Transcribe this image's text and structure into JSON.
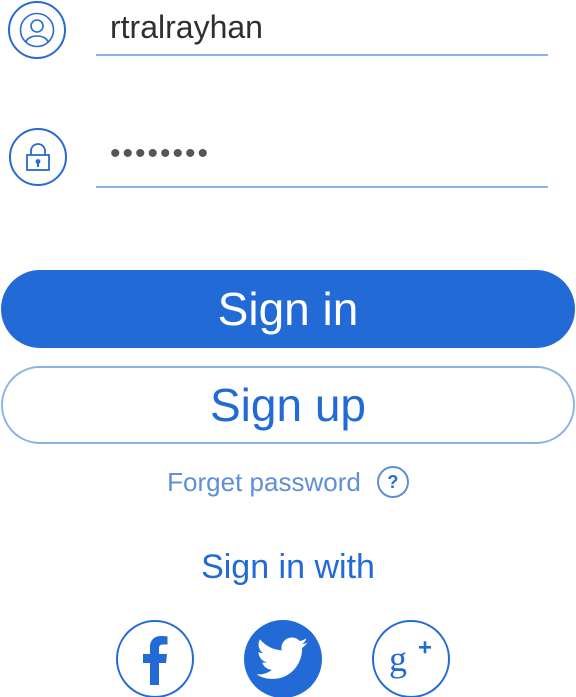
{
  "login": {
    "username_value": "rtralrayhan",
    "password_value": "••••••••",
    "signin_label": "Sign in",
    "signup_label": "Sign up",
    "forget_label": "Forget password",
    "help_symbol": "?",
    "signin_with_label": "Sign in with"
  },
  "icons": {
    "user": "user-icon",
    "lock": "lock-icon",
    "facebook": "facebook-icon",
    "twitter": "twitter-icon",
    "google": "google-plus-icon"
  },
  "colors": {
    "primary": "#226ad6",
    "field_underline": "#8cb3e8",
    "link": "#5f8fd6",
    "text": "#2f2f2f"
  }
}
